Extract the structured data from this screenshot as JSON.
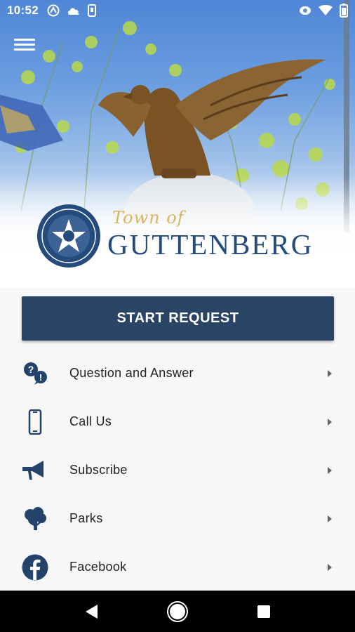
{
  "status_bar": {
    "time": "10:52",
    "left_icons": [
      "app-notification-icon",
      "cloud-icon",
      "phone-notification-icon"
    ],
    "right_icons": [
      "eye-icon",
      "wifi-icon",
      "battery-icon"
    ]
  },
  "hero": {
    "logo_script": "Town of",
    "logo_name": "GUTTENBERG",
    "menu_icon": "hamburger-menu-icon"
  },
  "start_button": {
    "label": "START REQUEST"
  },
  "menu_items": [
    {
      "label": "Question and Answer",
      "icon": "question-answer-icon"
    },
    {
      "label": "Call Us",
      "icon": "phone-icon"
    },
    {
      "label": "Subscribe",
      "icon": "megaphone-icon"
    },
    {
      "label": "Parks",
      "icon": "tree-icon"
    },
    {
      "label": "Facebook",
      "icon": "facebook-icon"
    }
  ],
  "colors": {
    "primary": "#2a4466",
    "logo_blue": "#254a7c",
    "logo_gold": "#d9b45a",
    "icon": "#24436b"
  }
}
